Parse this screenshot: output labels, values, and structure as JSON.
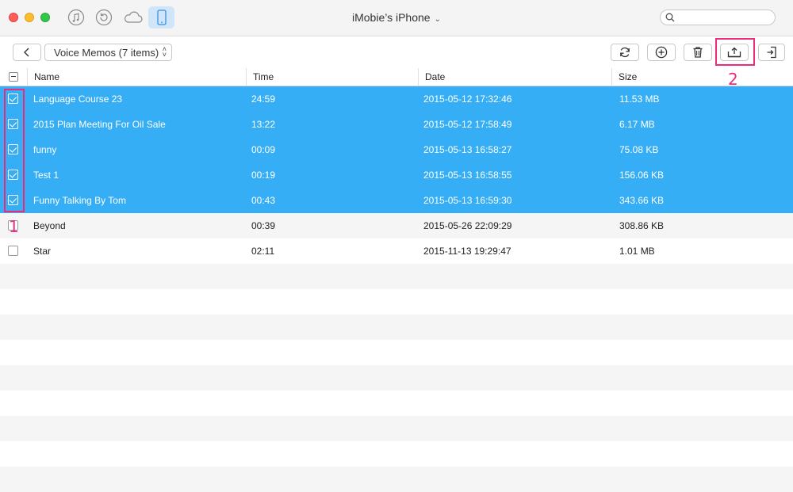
{
  "window": {
    "title": "iMobie’s iPhone"
  },
  "titlebar_icons": [
    {
      "name": "music-icon"
    },
    {
      "name": "history-icon"
    },
    {
      "name": "cloud-icon"
    },
    {
      "name": "iphone-icon"
    }
  ],
  "search": {
    "placeholder": "",
    "value": ""
  },
  "toolbar": {
    "category_label": "Voice Memos (7 items)",
    "actions": [
      "refresh-icon",
      "add-icon",
      "delete-icon",
      "export-to-computer-icon",
      "send-to-device-icon"
    ]
  },
  "annotations": {
    "step1": "1",
    "step2": "2",
    "color": "#ec2b7c"
  },
  "table": {
    "columns": [
      "Name",
      "Time",
      "Date",
      "Size"
    ],
    "rows": [
      {
        "name": "Language Course 23",
        "time": "24:59",
        "date": "2015-05-12 17:32:46",
        "size": "11.53 MB",
        "selected": true
      },
      {
        "name": "2015 Plan Meeting For Oil Sale",
        "time": "13:22",
        "date": "2015-05-12 17:58:49",
        "size": "6.17 MB",
        "selected": true
      },
      {
        "name": "funny",
        "time": "00:09",
        "date": "2015-05-13 16:58:27",
        "size": "75.08 KB",
        "selected": true
      },
      {
        "name": "Test 1",
        "time": "00:19",
        "date": "2015-05-13 16:58:55",
        "size": "156.06 KB",
        "selected": true
      },
      {
        "name": "Funny Talking By Tom",
        "time": "00:43",
        "date": "2015-05-13 16:59:30",
        "size": "343.66 KB",
        "selected": true
      },
      {
        "name": "Beyond",
        "time": "00:39",
        "date": "2015-05-26 22:09:29",
        "size": "308.86 KB",
        "selected": false
      },
      {
        "name": "Star",
        "time": "02:11",
        "date": "2015-11-13 19:29:47",
        "size": "1.01 MB",
        "selected": false
      }
    ]
  },
  "colors": {
    "selection": "#36aef5",
    "highlight": "#ec2b7c"
  }
}
